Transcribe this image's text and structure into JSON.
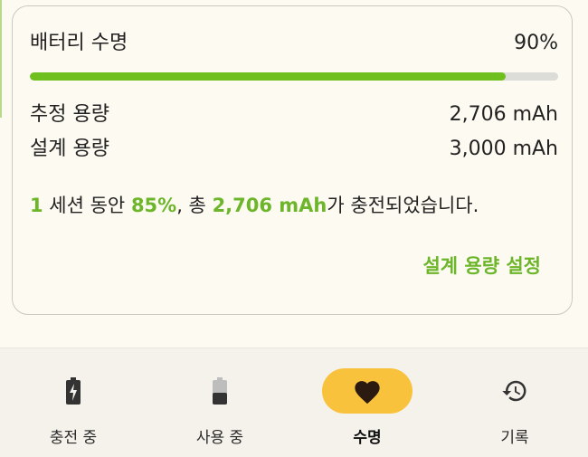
{
  "battery_life": {
    "title": "배터리 수명",
    "percent_label": "90%",
    "health_fraction": 0.9,
    "estimated_label": "추정 용량",
    "estimated_value": "2,706 mAh",
    "design_label": "설계 용량",
    "design_value": "3,000 mAh"
  },
  "summary": {
    "sessions": "1",
    "text_1": " 세션 동안 ",
    "percent": "85%",
    "text_2": ", 총 ",
    "mah": "2,706 mAh",
    "text_3": "가 충전되었습니다."
  },
  "set_design_capacity_label": "설계 용량 설정",
  "colors": {
    "accent_green": "#6db52a",
    "progress_green": "#6fbf1f",
    "active_tab_yellow": "#f9c23c"
  },
  "nav": {
    "items": [
      {
        "label": "충전 중",
        "icon": "battery-charging-icon"
      },
      {
        "label": "사용 중",
        "icon": "battery-discharging-icon"
      },
      {
        "label": "수명",
        "icon": "heart-icon",
        "active": true
      },
      {
        "label": "기록",
        "icon": "history-icon"
      }
    ]
  }
}
